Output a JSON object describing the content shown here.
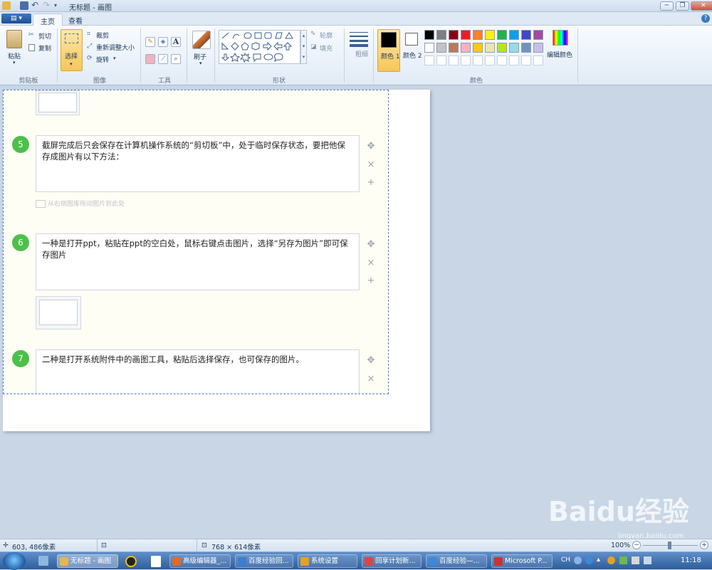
{
  "window": {
    "title": "无标题 - 画图",
    "min": "─",
    "max": "❐",
    "close": "✕"
  },
  "tabs": {
    "file": "▤ ▾",
    "home": "主页",
    "view": "查看",
    "help": "?"
  },
  "ribbon": {
    "clipboard": {
      "paste": "粘贴",
      "cut": "剪切",
      "copy": "复制",
      "label": "剪贴板"
    },
    "image": {
      "select": "选择",
      "crop": "裁剪",
      "resize": "重新调整大小",
      "rotate": "旋转",
      "label": "图像"
    },
    "tools": {
      "label": "工具"
    },
    "brushes": {
      "label": "刷子"
    },
    "shapes": {
      "outline": "轮廓",
      "fill": "填充",
      "label": "形状"
    },
    "size": {
      "label": "粗细"
    },
    "colors": {
      "color1": "颜色 1",
      "color2": "颜色 2",
      "edit": "编辑颜色",
      "label": "颜色",
      "row1": [
        "#000000",
        "#7f7f7f",
        "#880015",
        "#ed1c24",
        "#ff7f27",
        "#fff200",
        "#22b14c",
        "#00a2e8",
        "#3f48cc",
        "#a349a4"
      ],
      "row2": [
        "#ffffff",
        "#c3c3c3",
        "#b97a57",
        "#ffaec9",
        "#ffc90e",
        "#efe4b0",
        "#b5e61d",
        "#99d9ea",
        "#7092be",
        "#c8bfe7"
      ],
      "primary": "#000000",
      "secondary": "#ffffff"
    }
  },
  "steps": [
    {
      "num": "5",
      "text": "截屏完成后只会保存在计算机操作系统的“剪切板”中，处于临时保存状态，要把他保存成图片有以下方法："
    },
    {
      "num": "6",
      "text": "一种是打开ppt，粘贴在ppt的空白处，鼠标右键点击图片，选择“另存为图片”即可保存图片"
    },
    {
      "num": "7",
      "text": "二种是打开系统附件中的画图工具，粘贴后选择保存，也可保存的图片。"
    }
  ],
  "hint": "从右侧图库拖动图片到此处",
  "controls": {
    "move": "✥",
    "delete": "×",
    "add": "+"
  },
  "status": {
    "cursor": "603, 486像素",
    "size": "768 × 614像素",
    "zoom": "100%"
  },
  "taskbar": {
    "items": [
      "无标题 - 画图",
      "高级编辑器_...",
      "百度经验回...",
      "系统设置",
      "回享计划新...",
      "百度经验—...",
      "Microsoft P..."
    ],
    "ime": "CH",
    "clock": "11:18"
  },
  "watermark": {
    "main": "Baidu经验",
    "sub": "jingyan.baidu.com"
  }
}
